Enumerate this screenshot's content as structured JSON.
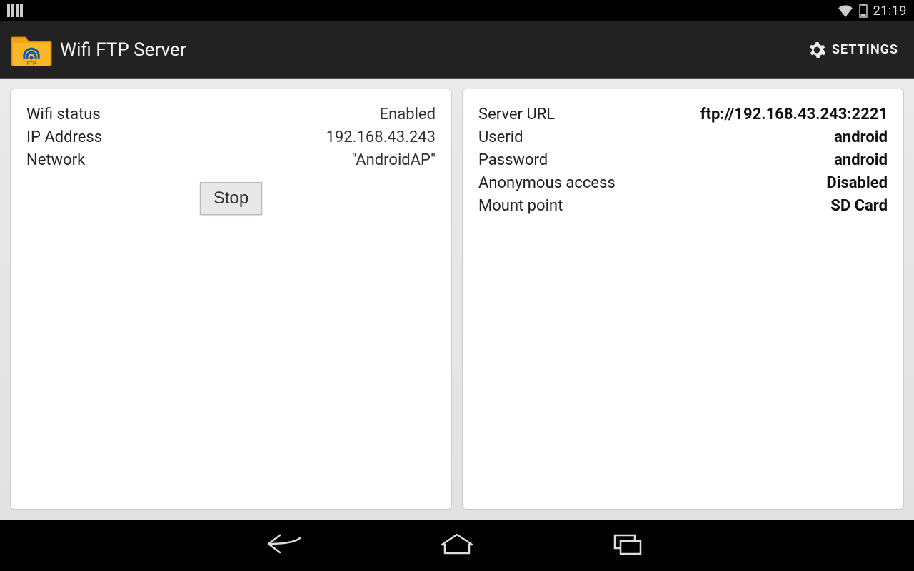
{
  "status_bar": {
    "time": "21:19"
  },
  "action_bar": {
    "title": "Wifi FTP Server",
    "settings_label": "SETTINGS"
  },
  "left_card": {
    "wifi_status_label": "Wifi status",
    "wifi_status_value": "Enabled",
    "ip_label": "IP Address",
    "ip_value": "192.168.43.243",
    "network_label": "Network",
    "network_value": "\"AndroidAP\"",
    "stop_button": "Stop"
  },
  "right_card": {
    "server_url_label": "Server URL",
    "server_url_value": "ftp://192.168.43.243:2221",
    "userid_label": "Userid",
    "userid_value": "android",
    "password_label": "Password",
    "password_value": "android",
    "anon_label": "Anonymous access",
    "anon_value": "Disabled",
    "mount_label": "Mount point",
    "mount_value": "SD Card"
  }
}
